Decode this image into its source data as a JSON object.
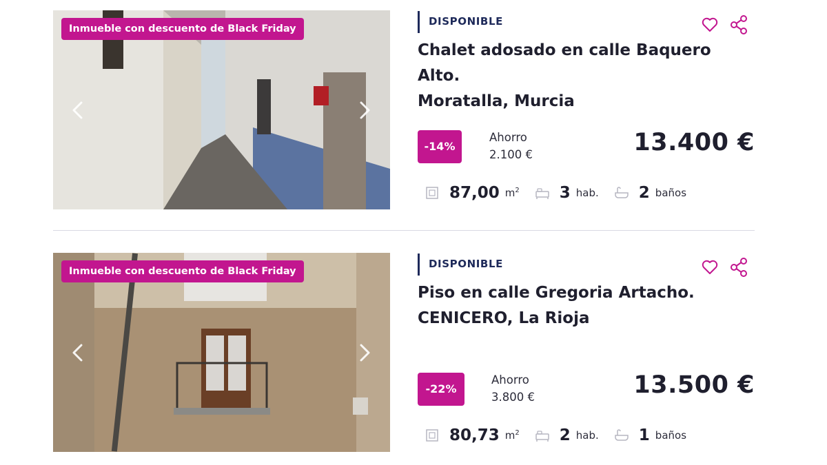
{
  "listings": [
    {
      "promo_badge": "Inmueble con descuento de Black Friday",
      "status": "DISPONIBLE",
      "title_line1": "Chalet adosado en calle Baquero Alto.",
      "title_line2": "Moratalla, Murcia",
      "discount": "-14%",
      "savings_label": "Ahorro",
      "savings_value": "2.100 €",
      "price": "13.400 €",
      "area_value": "87,00",
      "area_unit": "m",
      "area_unit_sup": "2",
      "rooms_value": "3",
      "rooms_unit": "hab.",
      "baths_value": "2",
      "baths_unit": "baños"
    },
    {
      "promo_badge": "Inmueble con descuento de Black Friday",
      "status": "DISPONIBLE",
      "title_line1": "Piso en calle Gregoria Artacho.",
      "title_line2": "CENICERO, La Rioja",
      "discount": "-22%",
      "savings_label": "Ahorro",
      "savings_value": "3.800 €",
      "price": "13.500 €",
      "area_value": "80,73",
      "area_unit": "m",
      "area_unit_sup": "2",
      "rooms_value": "2",
      "rooms_unit": "hab.",
      "baths_value": "1",
      "baths_unit": "baños"
    }
  ],
  "icons": {
    "favorite": "heart-icon",
    "share": "share-icon",
    "prev": "chevron-left-icon",
    "next": "chevron-right-icon",
    "area": "area-icon",
    "rooms": "bed-icon",
    "baths": "bathtub-icon"
  },
  "colors": {
    "accent": "#c2168f",
    "status": "#1e2a5a",
    "text": "#1f1f2e"
  }
}
